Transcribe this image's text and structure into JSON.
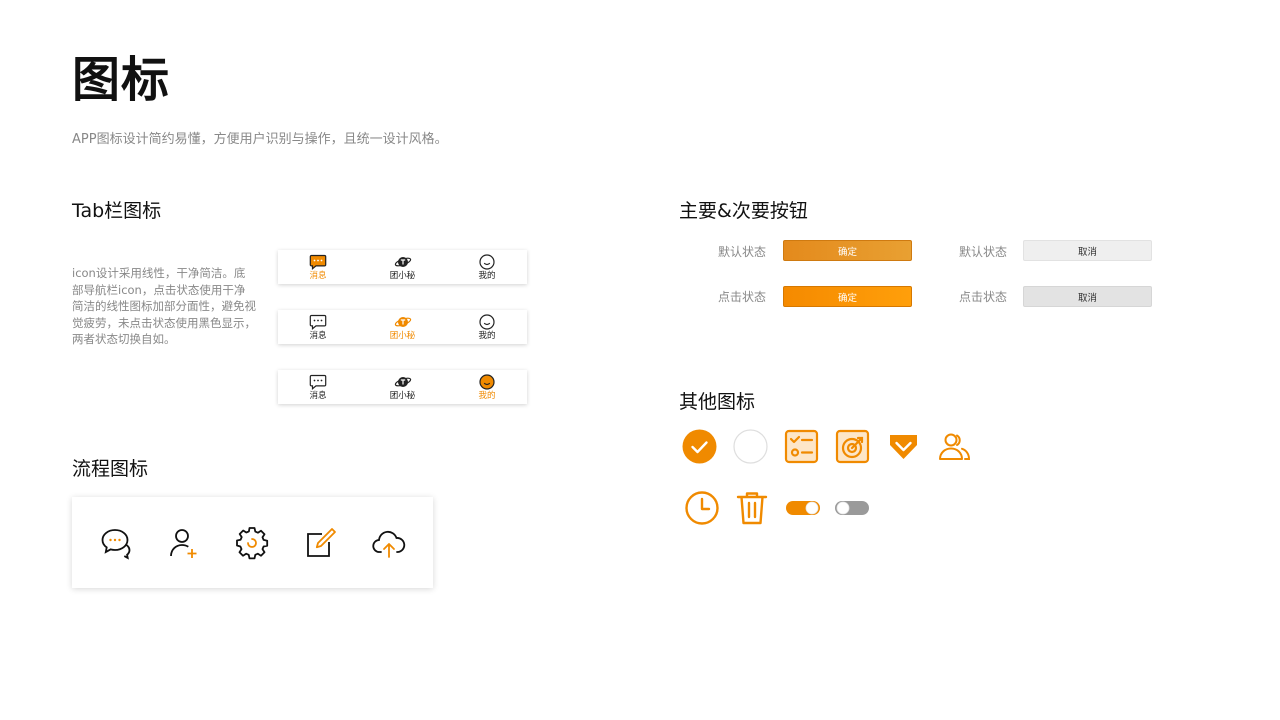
{
  "page": {
    "title": "图标",
    "subtitle": "APP图标设计简约易懂，方便用户识别与操作，且统一设计风格。"
  },
  "colors": {
    "accent": "#f08a00",
    "text": "#111111",
    "muted": "#888888"
  },
  "tab_section": {
    "title": "Tab栏图标",
    "description": "icon设计采用线性，干净简洁。底部导航栏icon，点击状态使用干净简洁的线性图标加部分面性，避免视觉疲劳，未点击状态使用黑色显示，两者状态切换自如。",
    "bars": [
      {
        "active": 0,
        "items": [
          {
            "label": "消息",
            "icon": "message-icon"
          },
          {
            "label": "团小秘",
            "icon": "planet-icon"
          },
          {
            "label": "我的",
            "icon": "smile-face-icon"
          }
        ]
      },
      {
        "active": 1,
        "items": [
          {
            "label": "消息",
            "icon": "message-icon"
          },
          {
            "label": "团小秘",
            "icon": "planet-icon"
          },
          {
            "label": "我的",
            "icon": "smile-face-icon"
          }
        ]
      },
      {
        "active": 2,
        "items": [
          {
            "label": "消息",
            "icon": "message-icon"
          },
          {
            "label": "团小秘",
            "icon": "planet-icon"
          },
          {
            "label": "我的",
            "icon": "smile-face-icon"
          }
        ]
      }
    ]
  },
  "flow_section": {
    "title": "流程图标",
    "icons": [
      "chat-bubbles-icon",
      "add-user-icon",
      "gear-icon",
      "edit-icon",
      "cloud-upload-icon"
    ]
  },
  "buttons_section": {
    "title": "主要&次要按钮",
    "default_label": "默认状态",
    "press_label": "点击状态",
    "primary_label": "确定",
    "secondary_label": "取消"
  },
  "other_section": {
    "title": "其他图标",
    "icons": [
      "check-circle-icon",
      "empty-circle-icon",
      "checklist-icon",
      "target-icon",
      "diamond-check-icon",
      "users-icon",
      "clock-icon",
      "trash-icon",
      "toggle-on-icon",
      "toggle-off-icon"
    ]
  }
}
